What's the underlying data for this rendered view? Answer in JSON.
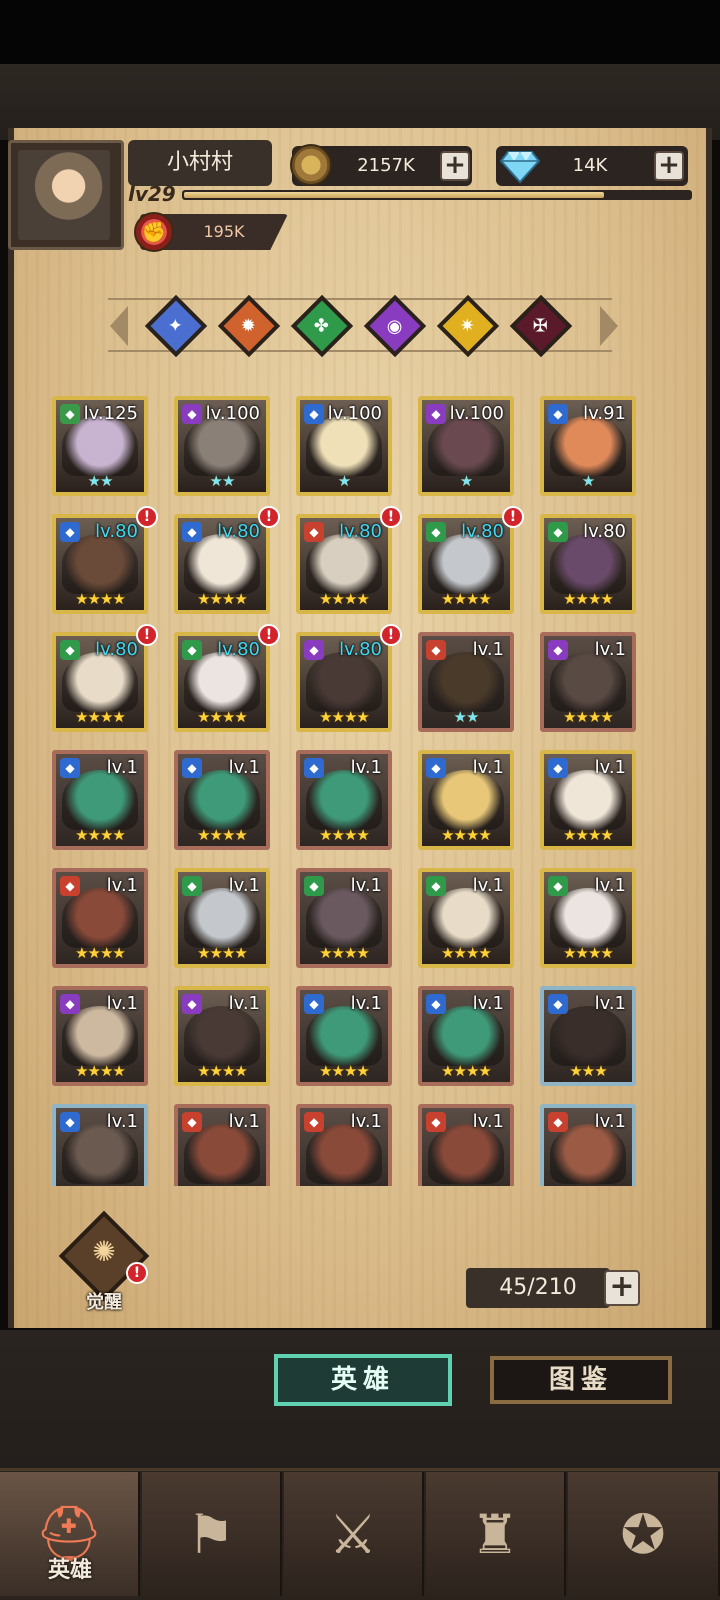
{
  "header": {
    "player_name": "小村村",
    "level": "lv29",
    "xp_fraction": 0.83,
    "gold": "2157K",
    "gems": "14K",
    "power": "195K"
  },
  "factions": [
    {
      "name": "light-blue-faction-icon",
      "color": "#4a6fd0",
      "glyph": "✦"
    },
    {
      "name": "orange-faction-icon",
      "color": "#d0622e",
      "glyph": "✹"
    },
    {
      "name": "green-faction-icon",
      "color": "#2f9a4a",
      "glyph": "✤"
    },
    {
      "name": "purple-faction-icon",
      "color": "#8a3cc0",
      "glyph": "◉"
    },
    {
      "name": "yellow-faction-icon",
      "color": "#e0b020",
      "glyph": "✷"
    },
    {
      "name": "dark-faction-icon",
      "color": "#5a1a2a",
      "glyph": "✠"
    }
  ],
  "heroes": [
    {
      "level": "lv.125",
      "stars": "★★",
      "star_color": "cyan",
      "lvl_color": "white",
      "badge": false,
      "frame": "rare",
      "cls_color": "#3a9a4a",
      "hue": "#c8b4d0"
    },
    {
      "level": "lv.100",
      "stars": "★★",
      "star_color": "cyan",
      "lvl_color": "white",
      "badge": false,
      "frame": "rare",
      "cls_color": "#8a3cc0",
      "hue": "#8a8078"
    },
    {
      "level": "lv.100",
      "stars": "★",
      "star_color": "cyan",
      "lvl_color": "white",
      "badge": false,
      "frame": "rare",
      "cls_color": "#2e6ad0",
      "hue": "#efe0b8"
    },
    {
      "level": "lv.100",
      "stars": "★",
      "star_color": "cyan",
      "lvl_color": "white",
      "badge": false,
      "frame": "rare",
      "cls_color": "#8a3cc0",
      "hue": "#6a4a50"
    },
    {
      "level": "lv.91",
      "stars": "★",
      "star_color": "cyan",
      "lvl_color": "white",
      "badge": false,
      "frame": "rare",
      "cls_color": "#2e6ad0",
      "hue": "#e08a5a"
    },
    {
      "level": "lv.80",
      "stars": "★★★★",
      "star_color": "gold",
      "lvl_color": "cyan",
      "badge": true,
      "frame": "rare",
      "cls_color": "#2e6ad0",
      "hue": "#6a4a38"
    },
    {
      "level": "lv.80",
      "stars": "★★★★",
      "star_color": "gold",
      "lvl_color": "cyan",
      "badge": true,
      "frame": "rare",
      "cls_color": "#2e6ad0",
      "hue": "#efe6d8"
    },
    {
      "level": "lv.80",
      "stars": "★★★★",
      "star_color": "gold",
      "lvl_color": "cyan",
      "badge": true,
      "frame": "rare",
      "cls_color": "#c8402e",
      "hue": "#d8cfc0"
    },
    {
      "level": "lv.80",
      "stars": "★★★★",
      "star_color": "gold",
      "lvl_color": "cyan",
      "badge": true,
      "frame": "rare",
      "cls_color": "#2f9a4a",
      "hue": "#c4c8cc"
    },
    {
      "level": "lv.80",
      "stars": "★★★★",
      "star_color": "gold",
      "lvl_color": "white",
      "badge": false,
      "frame": "rare",
      "cls_color": "#2f9a4a",
      "hue": "#6a4a6a"
    },
    {
      "level": "lv.80",
      "stars": "★★★★",
      "star_color": "gold",
      "lvl_color": "cyan",
      "badge": true,
      "frame": "rare",
      "cls_color": "#2f9a4a",
      "hue": "#e8dcc8"
    },
    {
      "level": "lv.80",
      "stars": "★★★★",
      "star_color": "gold",
      "lvl_color": "cyan",
      "badge": true,
      "frame": "rare",
      "cls_color": "#2f9a4a",
      "hue": "#ece4e0"
    },
    {
      "level": "lv.80",
      "stars": "★★★★",
      "star_color": "gold",
      "lvl_color": "cyan",
      "badge": true,
      "frame": "rare",
      "cls_color": "#8a3cc0",
      "hue": "#4a3a36"
    },
    {
      "level": "lv.1",
      "stars": "★★",
      "star_color": "cyan",
      "lvl_color": "white",
      "badge": false,
      "frame": "bronze",
      "cls_color": "#c8402e",
      "hue": "#4a3a2a"
    },
    {
      "level": "lv.1",
      "stars": "★★★★",
      "star_color": "gold",
      "lvl_color": "white",
      "badge": false,
      "frame": "bronze",
      "cls_color": "#8a3cc0",
      "hue": "#5a4a44"
    },
    {
      "level": "lv.1",
      "stars": "★★★★",
      "star_color": "gold",
      "lvl_color": "white",
      "badge": false,
      "frame": "bronze",
      "cls_color": "#2e6ad0",
      "hue": "#3f9a7a"
    },
    {
      "level": "lv.1",
      "stars": "★★★★",
      "star_color": "gold",
      "lvl_color": "white",
      "badge": false,
      "frame": "bronze",
      "cls_color": "#2e6ad0",
      "hue": "#3f9a7a"
    },
    {
      "level": "lv.1",
      "stars": "★★★★",
      "star_color": "gold",
      "lvl_color": "white",
      "badge": false,
      "frame": "bronze",
      "cls_color": "#2e6ad0",
      "hue": "#3f9a7a"
    },
    {
      "level": "lv.1",
      "stars": "★★★★",
      "star_color": "gold",
      "lvl_color": "white",
      "badge": false,
      "frame": "rare",
      "cls_color": "#2e6ad0",
      "hue": "#e8c878"
    },
    {
      "level": "lv.1",
      "stars": "★★★★",
      "star_color": "gold",
      "lvl_color": "white",
      "badge": false,
      "frame": "rare",
      "cls_color": "#2e6ad0",
      "hue": "#efe6d8"
    },
    {
      "level": "lv.1",
      "stars": "★★★★",
      "star_color": "gold",
      "lvl_color": "white",
      "badge": false,
      "frame": "bronze",
      "cls_color": "#c8402e",
      "hue": "#8a4a3a"
    },
    {
      "level": "lv.1",
      "stars": "★★★★",
      "star_color": "gold",
      "lvl_color": "white",
      "badge": false,
      "frame": "rare",
      "cls_color": "#2f9a4a",
      "hue": "#c4c8cc"
    },
    {
      "level": "lv.1",
      "stars": "★★★★",
      "star_color": "gold",
      "lvl_color": "white",
      "badge": false,
      "frame": "bronze",
      "cls_color": "#2f9a4a",
      "hue": "#6a5a60"
    },
    {
      "level": "lv.1",
      "stars": "★★★★",
      "star_color": "gold",
      "lvl_color": "white",
      "badge": false,
      "frame": "rare",
      "cls_color": "#2f9a4a",
      "hue": "#e8dcc8"
    },
    {
      "level": "lv.1",
      "stars": "★★★★",
      "star_color": "gold",
      "lvl_color": "white",
      "badge": false,
      "frame": "rare",
      "cls_color": "#2f9a4a",
      "hue": "#ece4e0"
    },
    {
      "level": "lv.1",
      "stars": "★★★★",
      "star_color": "gold",
      "lvl_color": "white",
      "badge": false,
      "frame": "bronze",
      "cls_color": "#8a3cc0",
      "hue": "#cdb8a0"
    },
    {
      "level": "lv.1",
      "stars": "★★★★",
      "star_color": "gold",
      "lvl_color": "white",
      "badge": false,
      "frame": "rare",
      "cls_color": "#8a3cc0",
      "hue": "#4a3a36"
    },
    {
      "level": "lv.1",
      "stars": "★★★★",
      "star_color": "gold",
      "lvl_color": "white",
      "badge": false,
      "frame": "bronze",
      "cls_color": "#2e6ad0",
      "hue": "#3f9a7a"
    },
    {
      "level": "lv.1",
      "stars": "★★★★",
      "star_color": "gold",
      "lvl_color": "white",
      "badge": false,
      "frame": "bronze",
      "cls_color": "#2e6ad0",
      "hue": "#3f9a7a"
    },
    {
      "level": "lv.1",
      "stars": "★★★",
      "star_color": "gold",
      "lvl_color": "white",
      "badge": false,
      "frame": "blue",
      "cls_color": "#2e6ad0",
      "hue": "#3a2e2a"
    },
    {
      "level": "lv.1",
      "stars": "",
      "star_color": "gold",
      "lvl_color": "white",
      "badge": false,
      "frame": "blue",
      "cls_color": "#2e6ad0",
      "hue": "#6a5a50"
    },
    {
      "level": "lv.1",
      "stars": "",
      "star_color": "gold",
      "lvl_color": "white",
      "badge": false,
      "frame": "bronze",
      "cls_color": "#c8402e",
      "hue": "#8a4a3a"
    },
    {
      "level": "lv.1",
      "stars": "",
      "star_color": "gold",
      "lvl_color": "white",
      "badge": false,
      "frame": "bronze",
      "cls_color": "#c8402e",
      "hue": "#8a4a3a"
    },
    {
      "level": "lv.1",
      "stars": "",
      "star_color": "gold",
      "lvl_color": "white",
      "badge": false,
      "frame": "bronze",
      "cls_color": "#c8402e",
      "hue": "#8a4a3a"
    },
    {
      "level": "lv.1",
      "stars": "",
      "star_color": "gold",
      "lvl_color": "white",
      "badge": false,
      "frame": "blue",
      "cls_color": "#c8402e",
      "hue": "#9a5a44"
    }
  ],
  "awaken": {
    "label": "觉醒",
    "badge": "!"
  },
  "hero_count": "45/210",
  "tabs": {
    "heroes": "英雄",
    "codex": "图鉴"
  },
  "nav": {
    "active_label": "英雄"
  }
}
